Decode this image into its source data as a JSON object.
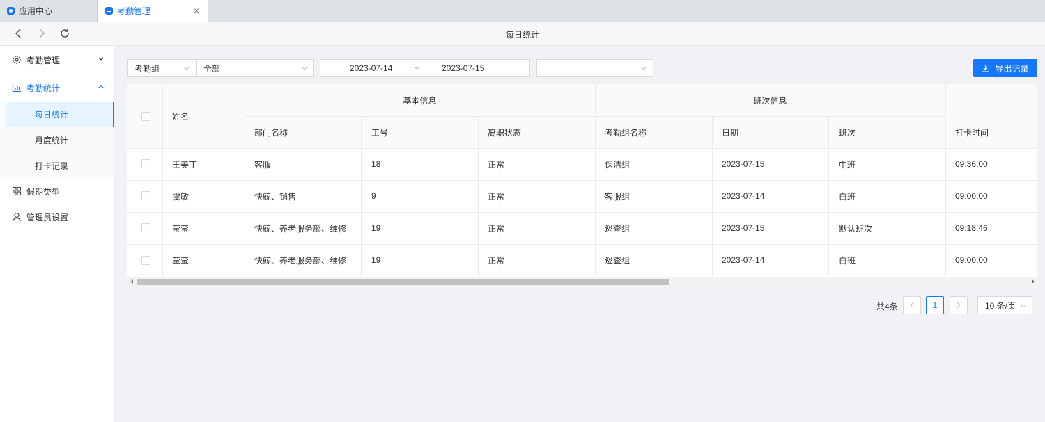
{
  "tabs": [
    {
      "label": "应用中心",
      "icon": "app-center-icon"
    },
    {
      "label": "考勤管理",
      "icon": "attendance-icon",
      "active": true
    }
  ],
  "toolbar": {
    "title": "每日统计"
  },
  "sidebar": {
    "items": [
      {
        "label": "考勤管理",
        "icon": "gear-icon"
      },
      {
        "label": "考勤统计",
        "icon": "bar-chart-icon"
      },
      {
        "label": "假期类型",
        "icon": "grid-icon"
      },
      {
        "label": "管理员设置",
        "icon": "user-icon"
      }
    ],
    "subitems": [
      {
        "label": "每日统计",
        "selected": true
      },
      {
        "label": "月度统计"
      },
      {
        "label": "打卡记录"
      }
    ]
  },
  "filters": {
    "group_select": "考勤组",
    "scope_select": "全部",
    "date_start": "2023-07-14",
    "date_sep": "~",
    "date_end": "2023-07-15",
    "extra_select": ""
  },
  "export_label": "导出记录",
  "table": {
    "group_headers": {
      "basic": "基本信息",
      "shift": "班次信息"
    },
    "columns": {
      "name": "姓名",
      "dept": "部门名称",
      "id": "工号",
      "status": "离职状态",
      "group": "考勤组名称",
      "date": "日期",
      "shift": "班次",
      "time": "打卡时间"
    },
    "rows": [
      {
        "name": "王美丁",
        "dept": "客服",
        "id": "18",
        "status": "正常",
        "group": "保洁组",
        "date": "2023-07-15",
        "shift": "中班",
        "time": "09:36:00"
      },
      {
        "name": "虞敏",
        "dept": "快鲸、销售",
        "id": "9",
        "status": "正常",
        "group": "客服组",
        "date": "2023-07-14",
        "shift": "白班",
        "time": "09:00:00"
      },
      {
        "name": "莹莹",
        "dept": "快鲸、养老服务部、维修",
        "id": "19",
        "status": "正常",
        "group": "巡查组",
        "date": "2023-07-15",
        "shift": "默认班次",
        "time": "09:18:46"
      },
      {
        "name": "莹莹",
        "dept": "快鲸、养老服务部、维修",
        "id": "19",
        "status": "正常",
        "group": "巡查组",
        "date": "2023-07-14",
        "shift": "白班",
        "time": "09:00:00"
      }
    ]
  },
  "pagination": {
    "total": "共4条",
    "current_page": "1",
    "page_size": "10 条/页"
  },
  "colors": {
    "accent": "#1677ff",
    "selected_bg": "#e6f4ff"
  }
}
